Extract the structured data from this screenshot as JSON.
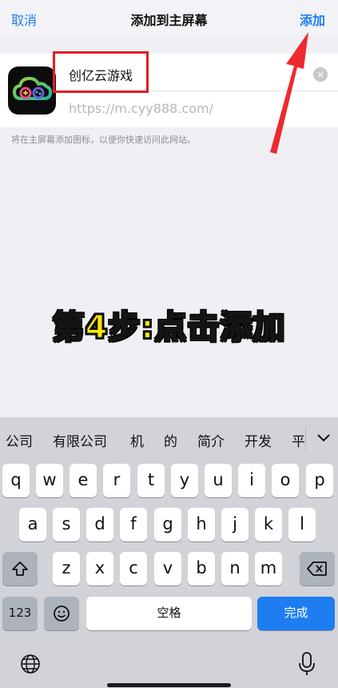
{
  "nav": {
    "cancel": "取消",
    "title": "添加到主屏幕",
    "add": "添加"
  },
  "form": {
    "name_value": "创亿云游戏",
    "url_placeholder": "https://m.cyy888.com/",
    "clear_symbol": "×"
  },
  "hint": "将在主屏幕添加图标，以便你快速访问此网站。",
  "caption": "第4步:点击添加",
  "keyboard": {
    "candidates": [
      "公司",
      "有限公司",
      "机",
      "的",
      "简介",
      "开发",
      "平"
    ],
    "row1": [
      "q",
      "w",
      "e",
      "r",
      "t",
      "y",
      "u",
      "i",
      "o",
      "p"
    ],
    "row2": [
      "a",
      "s",
      "d",
      "f",
      "g",
      "h",
      "j",
      "k",
      "l"
    ],
    "row3": [
      "z",
      "x",
      "c",
      "v",
      "b",
      "n",
      "m"
    ],
    "numbers_label": "123",
    "space_label": "空格",
    "done_label": "完成"
  },
  "colors": {
    "accent": "#1f7df2",
    "annotation_red": "#e01f26",
    "caption_yellow": "#ffeb00"
  }
}
